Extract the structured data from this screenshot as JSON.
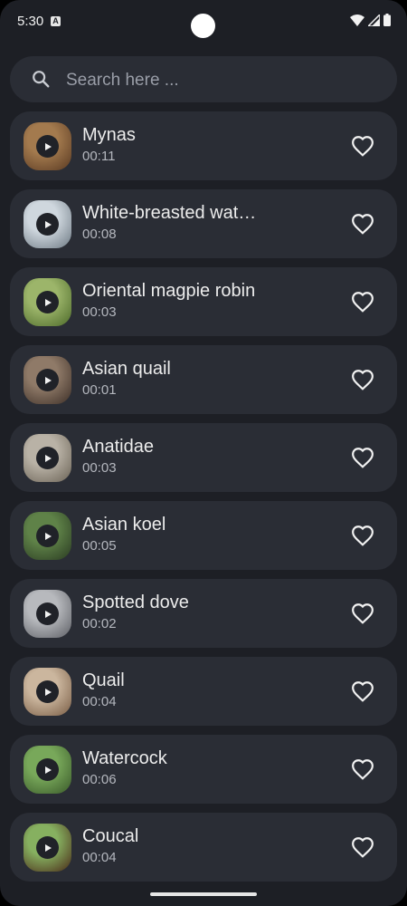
{
  "status_bar": {
    "time": "5:30",
    "notification_letter": "A"
  },
  "search": {
    "placeholder": "Search here ..."
  },
  "sounds": [
    {
      "title": "Mynas",
      "duration": "00:11",
      "thumb_colors": [
        "#a37a4e",
        "#5a3a22"
      ]
    },
    {
      "title": "White-breasted wate…",
      "duration": "00:08",
      "thumb_colors": [
        "#cfd7de",
        "#6e7a84"
      ]
    },
    {
      "title": "Oriental magpie robin",
      "duration": "00:03",
      "thumb_colors": [
        "#9cb56a",
        "#4d6a2a"
      ]
    },
    {
      "title": "Asian quail",
      "duration": "00:01",
      "thumb_colors": [
        "#8f7a68",
        "#3e3028"
      ]
    },
    {
      "title": "Anatidae",
      "duration": "00:03",
      "thumb_colors": [
        "#b9b2a6",
        "#6b6356"
      ]
    },
    {
      "title": "Asian koel",
      "duration": "00:05",
      "thumb_colors": [
        "#5f8248",
        "#2a3b22"
      ]
    },
    {
      "title": "Spotted dove",
      "duration": "00:02",
      "thumb_colors": [
        "#b7b9bd",
        "#5e6066"
      ]
    },
    {
      "title": "Quail",
      "duration": "00:04",
      "thumb_colors": [
        "#cbb69e",
        "#7a5e46"
      ]
    },
    {
      "title": "Watercock",
      "duration": "00:06",
      "thumb_colors": [
        "#78a85a",
        "#3a5a2a"
      ]
    },
    {
      "title": "Coucal",
      "duration": "00:04",
      "thumb_colors": [
        "#86b060",
        "#4a2a18"
      ]
    }
  ],
  "icons": {
    "search": "search-icon",
    "play": "play-icon",
    "favorite": "heart-outline-icon"
  },
  "colors": {
    "background": "#1d1f25",
    "card": "#2a2d35",
    "text": "#ececec",
    "subtext": "#b4b7be"
  }
}
